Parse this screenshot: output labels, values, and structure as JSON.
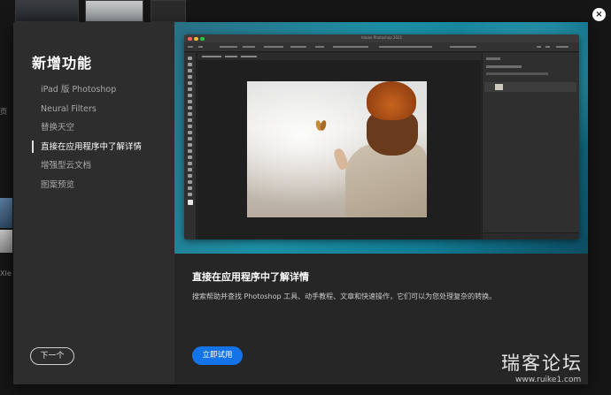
{
  "sidebar": {
    "title": "新增功能",
    "items": [
      {
        "label": "iPad 版 Photoshop",
        "active": false
      },
      {
        "label": "Neural Filters",
        "active": false
      },
      {
        "label": "替换天空",
        "active": false
      },
      {
        "label": "直接在应用程序中了解详情",
        "active": true
      },
      {
        "label": "增强型云文档",
        "active": false
      },
      {
        "label": "图案预览",
        "active": false
      }
    ],
    "next_label": "下一个"
  },
  "preview": {
    "app_window_title": "Adobe Photoshop 2021"
  },
  "content": {
    "headline": "直接在应用程序中了解详情",
    "description": "搜索帮助并查找 Photoshop 工具、动手教程、文章和快速操作，它们可以为您处理复杂的转换。",
    "try_label": "立即试用"
  },
  "close_icon": "×",
  "background": {
    "left_fragment_1": "页",
    "left_fragment_2": "XIe"
  },
  "watermark": {
    "main": "瑞客论坛",
    "sub": "www.ruike1.com"
  },
  "colors": {
    "accent_blue": "#1473e6",
    "hero_teal": "#1c8fa5",
    "sidebar_bg": "#2d2d2d",
    "content_bg": "#262626"
  }
}
